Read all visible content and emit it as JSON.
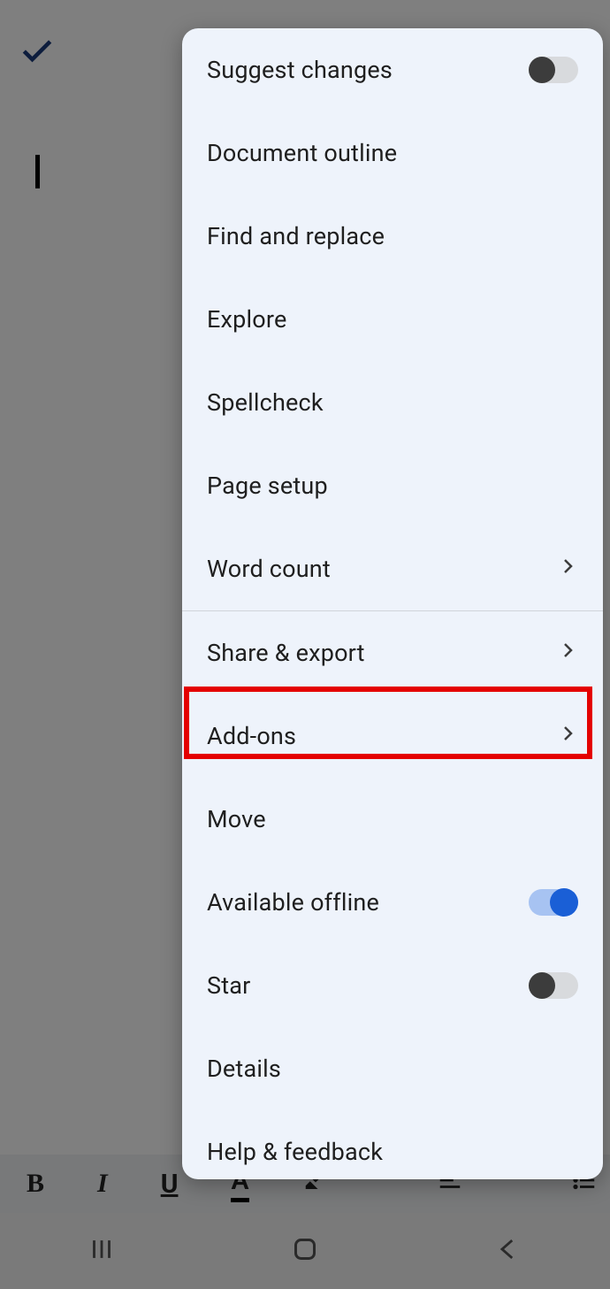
{
  "menu": {
    "items": [
      {
        "label": "Suggest changes",
        "control": "toggle",
        "state": "off"
      },
      {
        "label": "Document outline",
        "control": "none"
      },
      {
        "label": "Find and replace",
        "control": "none"
      },
      {
        "label": "Explore",
        "control": "none"
      },
      {
        "label": "Spellcheck",
        "control": "none"
      },
      {
        "label": "Page setup",
        "control": "none"
      },
      {
        "label": "Word count",
        "control": "chevron"
      },
      {
        "label": "Share & export",
        "control": "chevron",
        "dividerBefore": true
      },
      {
        "label": "Add-ons",
        "control": "chevron",
        "highlighted": true
      },
      {
        "label": "Move",
        "control": "none"
      },
      {
        "label": "Available offline",
        "control": "toggle",
        "state": "on"
      },
      {
        "label": "Star",
        "control": "toggle",
        "state": "off"
      },
      {
        "label": "Details",
        "control": "none"
      },
      {
        "label": "Help & feedback",
        "control": "none"
      }
    ]
  },
  "formatBar": {
    "bold": "B",
    "italic": "I",
    "underline": "U",
    "textcolor": "A"
  }
}
